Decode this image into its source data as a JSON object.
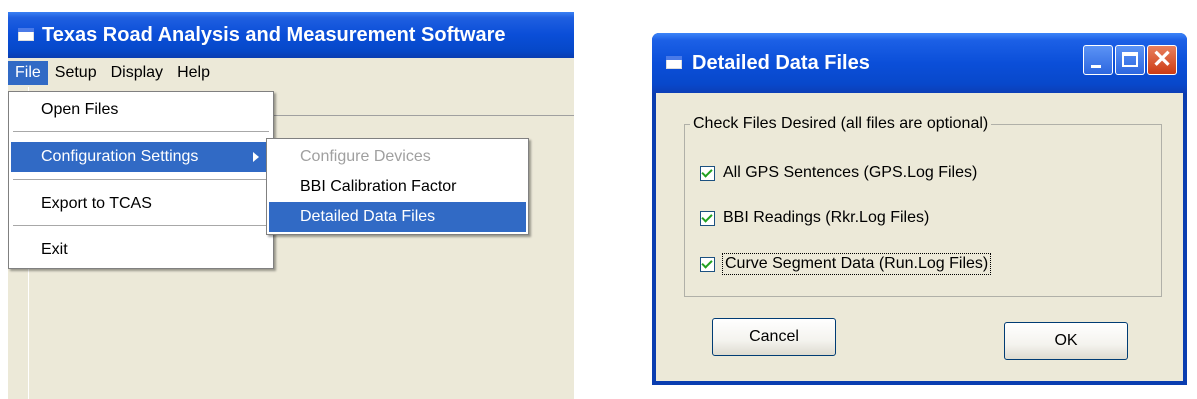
{
  "left_window": {
    "title": "Texas Road Analysis and Measurement Software",
    "menu": [
      "File",
      "Setup",
      "Display",
      "Help"
    ],
    "file_menu": {
      "open_files": "Open Files",
      "configuration_settings": "Configuration Settings",
      "export": "Export to TCAS",
      "exit": "Exit"
    },
    "submenu": {
      "configure_devices": "Configure Devices",
      "bbi_calibration": "BBI Calibration Factor",
      "detailed_data_files": "Detailed Data Files"
    }
  },
  "dialog": {
    "title": "Detailed Data Files",
    "group_label": "Check Files Desired (all files are optional)",
    "options": [
      {
        "label": "All GPS Sentences (GPS.Log Files)",
        "checked": true
      },
      {
        "label": "BBI Readings (Rkr.Log Files)",
        "checked": true
      },
      {
        "label": "Curve Segment Data (Run.Log Files)",
        "checked": true
      }
    ],
    "cancel_label": "Cancel",
    "ok_label": "OK",
    "close_glyph": "✕"
  },
  "colors": {
    "titlebar": "#0a4ed8",
    "highlight": "#316ac5",
    "window_bg": "#ece9d8",
    "close_button": "#cd3b14"
  },
  "icons": [
    "app-window-icon",
    "submenu-arrow-icon",
    "minimize-icon",
    "maximize-icon",
    "close-icon",
    "checkmark-icon"
  ]
}
